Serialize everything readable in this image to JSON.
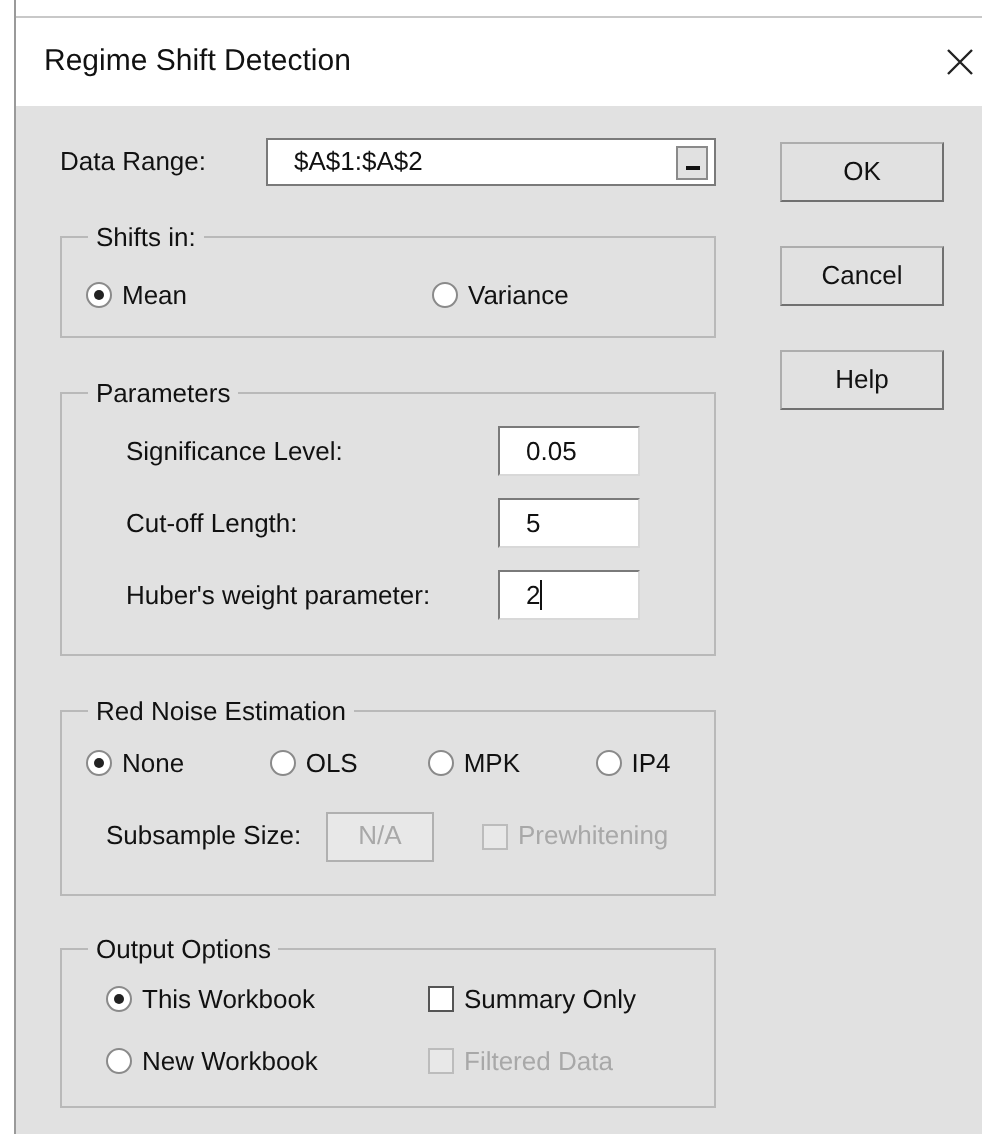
{
  "window": {
    "title": "Regime Shift Detection"
  },
  "data_range": {
    "label": "Data Range:",
    "value": "$A$1:$A$2"
  },
  "shifts_in": {
    "title": "Shifts in:",
    "options": [
      {
        "label": "Mean",
        "selected": true
      },
      {
        "label": "Variance",
        "selected": false
      }
    ]
  },
  "parameters": {
    "title": "Parameters",
    "fields": [
      {
        "label": "Significance Level:",
        "value": "0.05",
        "focused": false
      },
      {
        "label": "Cut-off Length:",
        "value": "5",
        "focused": false
      },
      {
        "label": "Huber's weight parameter:",
        "value": "2",
        "focused": true
      }
    ]
  },
  "red_noise": {
    "title": "Red Noise Estimation",
    "options": [
      {
        "label": "None",
        "selected": true
      },
      {
        "label": "OLS",
        "selected": false
      },
      {
        "label": "MPK",
        "selected": false
      },
      {
        "label": "IP4",
        "selected": false
      }
    ],
    "subsample": {
      "label": "Subsample Size:",
      "value": "N/A",
      "disabled": true
    },
    "prewhitening": {
      "label": "Prewhitening",
      "checked": false,
      "disabled": true
    }
  },
  "output_options": {
    "title": "Output Options",
    "options": [
      {
        "label": "This Workbook",
        "selected": true
      },
      {
        "label": "New Workbook",
        "selected": false
      }
    ],
    "checkboxes": [
      {
        "label": "Summary Only",
        "checked": false,
        "disabled": false
      },
      {
        "label": "Filtered Data",
        "checked": false,
        "disabled": true
      }
    ]
  },
  "buttons": [
    {
      "label": "OK"
    },
    {
      "label": "Cancel"
    },
    {
      "label": "Help"
    }
  ]
}
